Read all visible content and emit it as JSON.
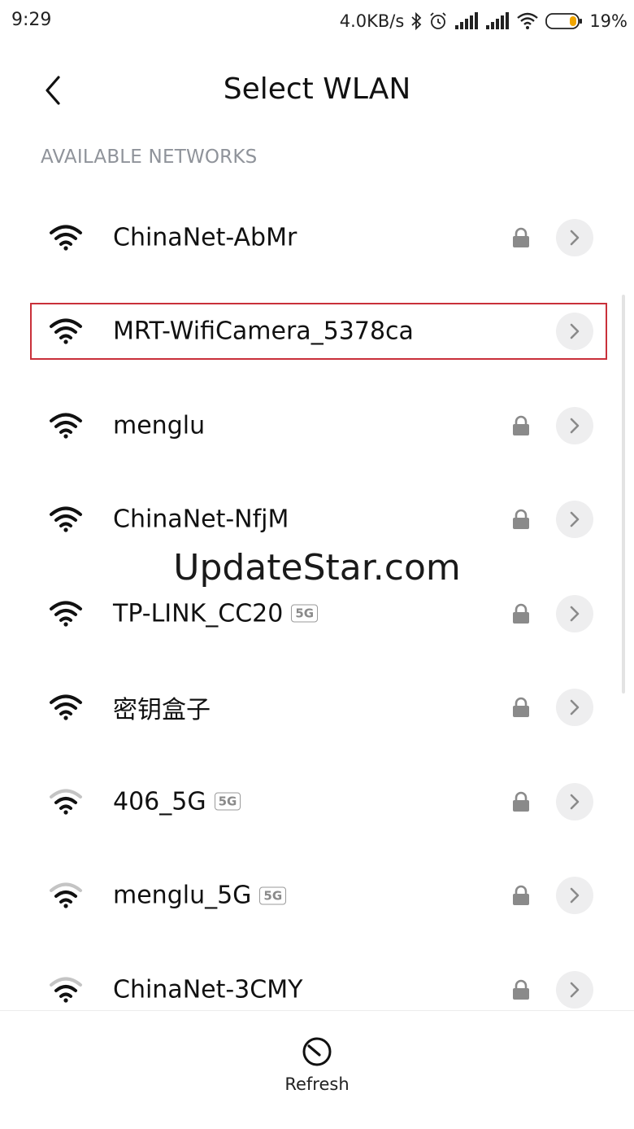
{
  "status_bar": {
    "time": "9:29",
    "speed": "4.0KB/s",
    "battery": "19%"
  },
  "header": {
    "title": "Select WLAN",
    "back_icon": "chevron-left-icon"
  },
  "section_label": "AVAILABLE NETWORKS",
  "networks": [
    {
      "name": "ChinaNet-AbMr",
      "band": "",
      "secured": true,
      "signal": "strong"
    },
    {
      "name": "MRT-WifiCamera_5378ca",
      "band": "",
      "secured": false,
      "signal": "strong"
    },
    {
      "name": "menglu",
      "band": "",
      "secured": true,
      "signal": "strong"
    },
    {
      "name": "ChinaNet-NfjM",
      "band": "",
      "secured": true,
      "signal": "strong"
    },
    {
      "name": "TP-LINK_CC20",
      "band": "5G",
      "secured": true,
      "signal": "strong"
    },
    {
      "name": "密钥盒子",
      "band": "",
      "secured": true,
      "signal": "strong"
    },
    {
      "name": "406_5G",
      "band": "5G",
      "secured": true,
      "signal": "medium"
    },
    {
      "name": "menglu_5G",
      "band": "5G",
      "secured": true,
      "signal": "medium"
    },
    {
      "name": "ChinaNet-3CMY",
      "band": "",
      "secured": true,
      "signal": "medium"
    }
  ],
  "watermark": "UpdateStar.com",
  "bottom": {
    "refresh_label": "Refresh"
  },
  "colors": {
    "highlight": "#c9303a",
    "section_label": "#8f939a",
    "detail_bg": "#eeeeef"
  }
}
